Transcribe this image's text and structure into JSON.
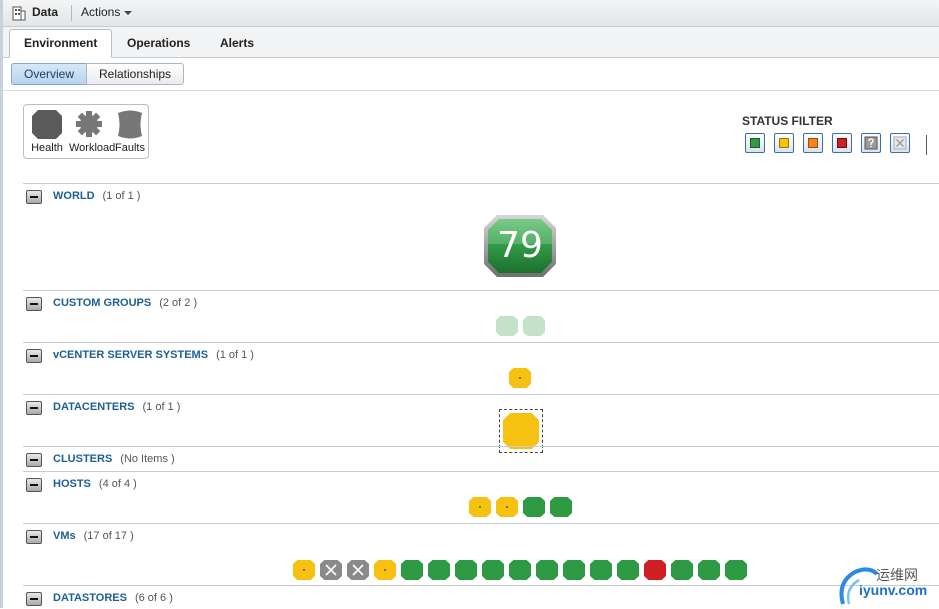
{
  "topbar": {
    "title": "Data",
    "actions_label": "Actions"
  },
  "tabs": [
    {
      "label": "Environment",
      "active": true
    },
    {
      "label": "Operations",
      "active": false
    },
    {
      "label": "Alerts",
      "active": false
    }
  ],
  "subtabs": [
    {
      "label": "Overview",
      "active": true
    },
    {
      "label": "Relationships",
      "active": false
    }
  ],
  "legend": {
    "health": "Health",
    "workload": "Workload",
    "faults": "Faults"
  },
  "status_filter": {
    "title": "STATUS FILTER",
    "buttons": [
      {
        "name": "green",
        "color": "#2e9a43"
      },
      {
        "name": "yellow",
        "color": "#f7c112"
      },
      {
        "name": "orange",
        "color": "#f58220"
      },
      {
        "name": "red",
        "color": "#cf1f25"
      },
      {
        "name": "unknown",
        "color": "#9a9a9a"
      },
      {
        "name": "none",
        "color": "#d0d4d8"
      }
    ]
  },
  "sections": {
    "world": {
      "name": "WORLD",
      "count": "(1 of 1 )",
      "badge_value": "79"
    },
    "custom_groups": {
      "name": "CUSTOM GROUPS",
      "count": "(2 of 2 )"
    },
    "vcenter": {
      "name": "vCENTER SERVER SYSTEMS",
      "count": "(1 of 1 )"
    },
    "datacenters": {
      "name": "DATACENTERS",
      "count": "(1 of 1 )"
    },
    "clusters": {
      "name": "CLUSTERS",
      "count": "(No Items )"
    },
    "hosts": {
      "name": "HOSTS",
      "count": "(4 of 4 )"
    },
    "vms": {
      "name": "VMs",
      "count": "(17 of 17 )"
    },
    "datastores": {
      "name": "DATASTORES",
      "count": "(6 of 6 )"
    }
  },
  "tiles": {
    "custom_groups": [
      "lightgreen",
      "lightgreen"
    ],
    "vcenter": [
      "yellow"
    ],
    "datacenters": [
      "yellow"
    ],
    "hosts": [
      "yellow",
      "yellow",
      "green",
      "green"
    ],
    "vms": [
      "yellow",
      "unknown",
      "unknown",
      "yellow",
      "green",
      "green",
      "green",
      "green",
      "green",
      "green",
      "green",
      "green",
      "green",
      "red",
      "green",
      "green",
      "green"
    ]
  },
  "colors": {
    "green": "#2e9a43",
    "yellow": "#f7c112",
    "red": "#cf1f25",
    "unknown": "#8a8a8a",
    "lightgreen": "#c3e2c8",
    "link": "#1d5f94"
  },
  "watermark": {
    "cn": "运维网",
    "en": "iyunv.com"
  }
}
